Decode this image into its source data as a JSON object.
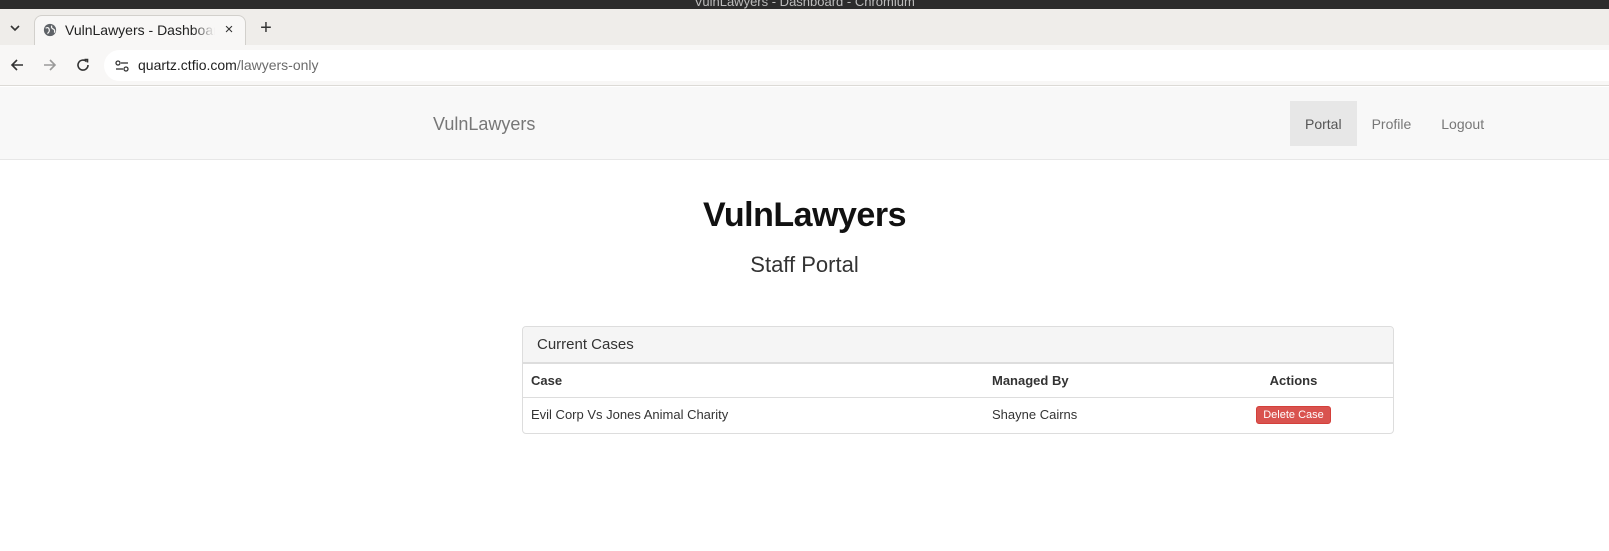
{
  "window": {
    "title": "VulnLawyers - Dashboard - Chromium"
  },
  "browser": {
    "tab": {
      "title": "VulnLawyers - Dashboard",
      "close_glyph": "×"
    },
    "new_tab_glyph": "+",
    "url": {
      "host": "quartz.ctfio.com",
      "path": "/lawyers-only"
    }
  },
  "site": {
    "brand": "VulnLawyers",
    "nav": [
      {
        "label": "Portal",
        "active": true
      },
      {
        "label": "Profile",
        "active": false
      },
      {
        "label": "Logout",
        "active": false
      }
    ],
    "heading": "VulnLawyers",
    "subheading": "Staff Portal",
    "panel": {
      "title": "Current Cases",
      "columns": [
        "Case",
        "Managed By",
        "Actions"
      ],
      "rows": [
        {
          "case": "Evil Corp Vs Jones Animal Charity",
          "managed_by": "Shayne Cairns",
          "action_label": "Delete Case"
        }
      ]
    }
  },
  "colors": {
    "danger": "#d9534f",
    "nav_bg": "#f8f8f8",
    "nav_active": "#e7e7e7"
  }
}
